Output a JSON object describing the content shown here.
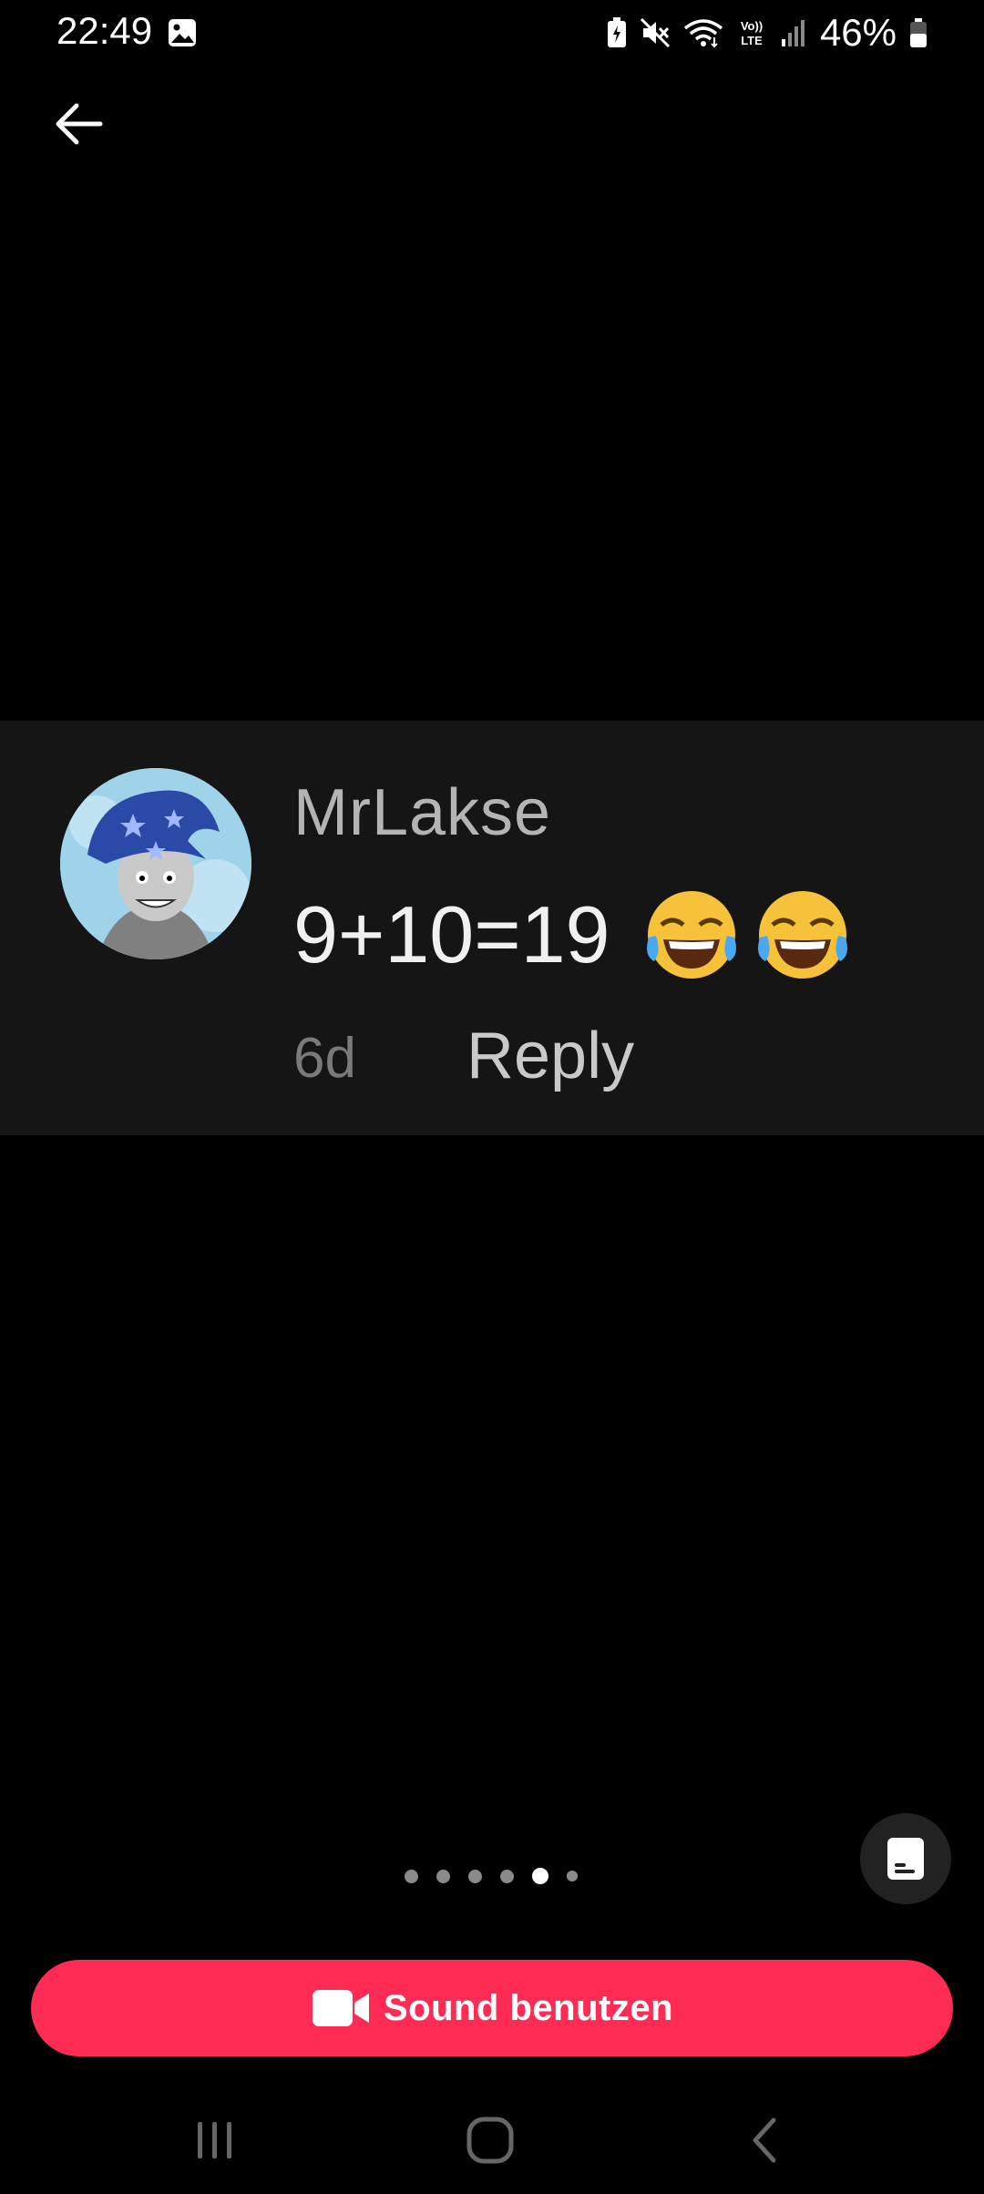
{
  "status_bar": {
    "time": "22:49",
    "battery": "46%",
    "icons": [
      "gallery-icon",
      "battery-saver-icon",
      "mute-icon",
      "wifi-icon",
      "volte-icon",
      "signal-icon",
      "battery-icon"
    ],
    "volte_label": "Vo)) LTE"
  },
  "nav": {
    "back_icon": "arrow-left-icon"
  },
  "comment": {
    "username": "MrLakse",
    "text": "9+10=19",
    "emojis": [
      "face-with-tears-of-joy",
      "face-with-tears-of-joy"
    ],
    "time": "6d",
    "reply_label": "Reply"
  },
  "pager": {
    "count": 6,
    "active_index": 4
  },
  "caption_icon": "captions-icon",
  "sound_button": {
    "label": "Sound benutzen",
    "icon": "video-camera-icon",
    "color": "#fe2c55"
  },
  "system_nav": [
    "recents-icon",
    "home-icon",
    "back-chevron-icon"
  ]
}
